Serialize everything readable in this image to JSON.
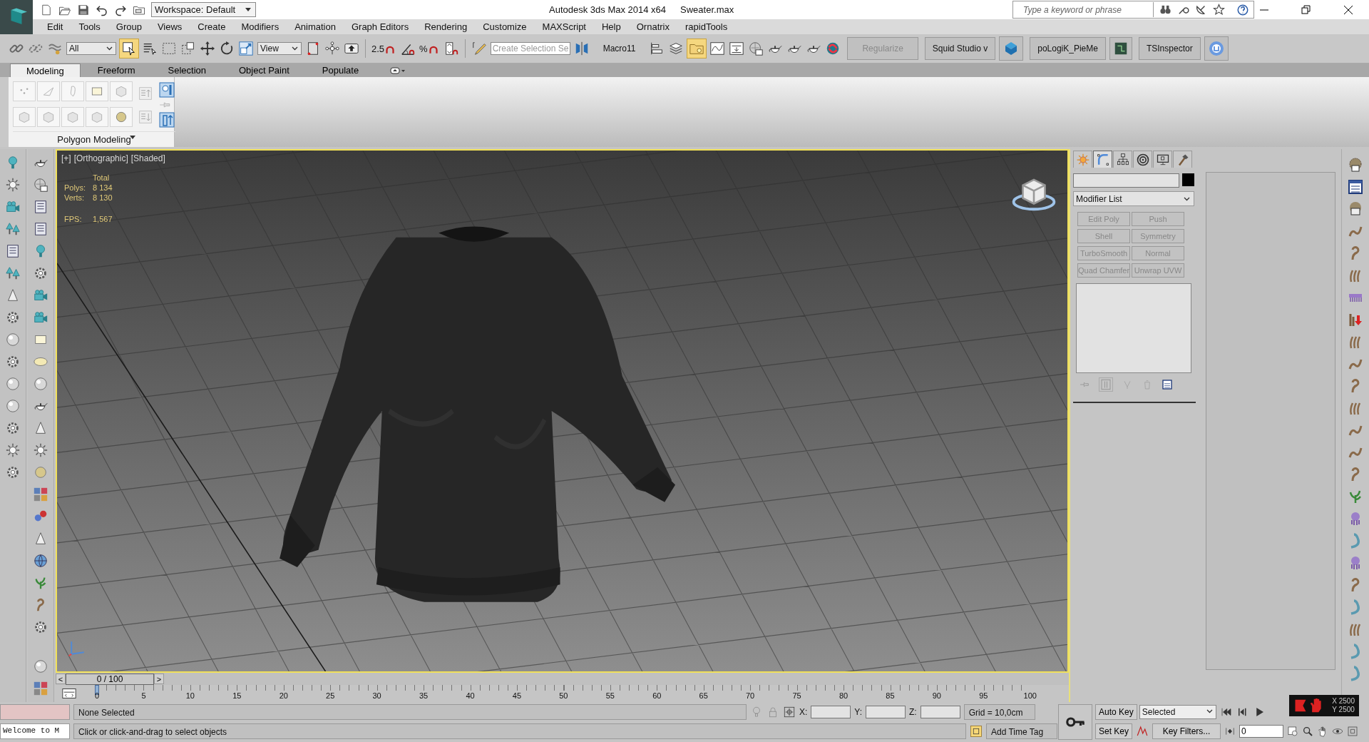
{
  "title_bar": {
    "workspace": "Workspace: Default",
    "title": "Autodesk 3ds Max  2014 x64",
    "file": "Sweater.max",
    "search": {
      "placeholder": "Type a keyword or phrase"
    }
  },
  "menu": [
    "Edit",
    "Tools",
    "Group",
    "Views",
    "Create",
    "Modifiers",
    "Animation",
    "Graph Editors",
    "Rendering",
    "Customize",
    "MAXScript",
    "Help",
    "Ornatrix",
    "rapidTools"
  ],
  "toolbar": {
    "selection_filter": "All",
    "select_object_active": true,
    "reference_coord": "View",
    "snap_label": "2.5",
    "percent_label": "%",
    "named_selection": {
      "placeholder": "Create Selection Se"
    },
    "macro": "Macro11",
    "scene_explorer_active": true,
    "extra_buttons": [
      {
        "label": "Regularize",
        "disabled": true
      },
      {
        "label": "Squid Studio v",
        "disabled": false
      },
      {
        "label": "poLogiK_PieMe",
        "disabled": false
      },
      {
        "label": "TSInspector",
        "disabled": false
      }
    ]
  },
  "ribbon": {
    "tabs": [
      {
        "label": "Modeling",
        "selected": true
      },
      {
        "label": "Freeform",
        "selected": false
      },
      {
        "label": "Selection",
        "selected": false
      },
      {
        "label": "Object Paint",
        "selected": false
      },
      {
        "label": "Populate",
        "selected": false
      }
    ],
    "panel_title": "Polygon Modeling"
  },
  "viewport": {
    "active": true,
    "labels": [
      "[+]",
      "[Orthographic]",
      "[Shaded]"
    ],
    "stats_header": "Total",
    "stats": [
      {
        "label": "Polys:",
        "value": "8 134"
      },
      {
        "label": "Verts:",
        "value": "8 130"
      },
      {
        "label": "FPS:",
        "value": "1,567"
      }
    ]
  },
  "command_panel": {
    "tabs": [
      {
        "selected": false
      },
      {
        "selected": true
      },
      {
        "selected": false
      },
      {
        "selected": false
      },
      {
        "selected": false
      },
      {
        "selected": false
      }
    ],
    "modifier_list": "Modifier List",
    "modifier_buttons": [
      {
        "label": "Edit Poly",
        "disabled": true
      },
      {
        "label": "Push",
        "disabled": true
      },
      {
        "label": "Shell",
        "disabled": true
      },
      {
        "label": "Symmetry",
        "disabled": true
      },
      {
        "label": "TurboSmooth",
        "disabled": true
      },
      {
        "label": "Normal",
        "disabled": true
      },
      {
        "label": "Quad Chamfer",
        "disabled": true
      },
      {
        "label": "Unwrap UVW",
        "disabled": true
      }
    ]
  },
  "time_slider": {
    "prev": "<",
    "label": "0 / 100",
    "next": ">"
  },
  "track_ticks": [
    "0",
    "5",
    "10",
    "15",
    "20",
    "25",
    "30",
    "35",
    "40",
    "45",
    "50",
    "55",
    "60",
    "65",
    "70",
    "75",
    "80",
    "85",
    "90",
    "95",
    "100"
  ],
  "status": {
    "maxscript": "Welcome to M",
    "selection": "None Selected",
    "prompt": "Click or click-and-drag to select objects",
    "x_label": "X:",
    "y_label": "Y:",
    "z_label": "Z:",
    "grid": "Grid = 10,0cm",
    "time_tag": "Add Time Tag"
  },
  "animation": {
    "auto_key": "Auto Key",
    "key_mode": "Selected",
    "set_key": "Set Key",
    "key_filters": "Key Filters...",
    "frame": "0"
  },
  "overlay": {
    "x": "X 2500",
    "y": "Y 2500"
  }
}
